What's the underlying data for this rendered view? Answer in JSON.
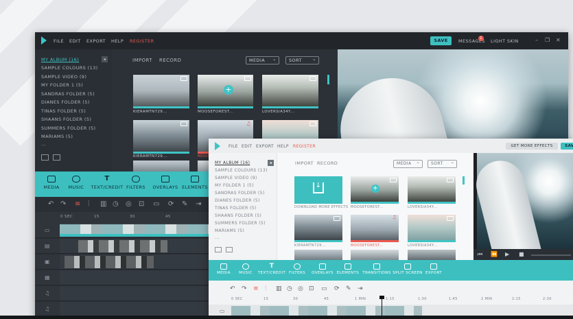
{
  "dark_window": {
    "menu": [
      "FILE",
      "EDIT",
      "EXPORT",
      "HELP",
      "REGISTER"
    ],
    "save_label": "SAVE",
    "messages_label": "MESSAGES",
    "messages_badge": "1",
    "skin_label": "LIGHT SKIN",
    "albums": [
      "MY ALBUM (16)",
      "SAMPLE COLOURS (13)",
      "SAMPLE VIDEO (9)",
      "MY FOLDER 1 (5)",
      "SANDRAS FOLDER (5)",
      "DIANES FOLDER (5)",
      "TINAS FOLDER (5)",
      "SHAANS FOLDER (5)",
      "SUMMERS FOLDER (5)",
      "MARIAMS (5)",
      "..."
    ],
    "import_label": "IMPORT",
    "record_label": "RECORD",
    "media_filter": "MEDIA",
    "sort_filter": "SORT",
    "thumbs": [
      "KIERAMTN729...",
      "MOOSEFOREST...",
      "LOVERSIA34Y...",
      "KIERAMTN729...",
      "MOOSEFOREST...",
      ""
    ],
    "toolbar": [
      "MEDIA",
      "MUSIC",
      "TEXT/CREDIT",
      "FILTERS",
      "OVERLAYS",
      "ELEMENTS"
    ],
    "ruler": [
      "0 SEC",
      "15",
      "30",
      "45"
    ]
  },
  "light_window": {
    "menu": [
      "FILE",
      "EDIT",
      "EXPORT",
      "HELP",
      "REGISTER"
    ],
    "get_more": "GET MORE EFFECTS",
    "save_label": "SAVE",
    "albums": [
      "MY ALBUM (16)",
      "SAMPLE COLOURS (13)",
      "SAMPLE VIDEO (9)",
      "MY FOLDER 1 (5)",
      "SANDRAS FOLDER (5)",
      "DIANES FOLDER (5)",
      "TINAS FOLDER (5)",
      "SHAANS FOLDER (5)",
      "SUMMERS FOLDER (5)",
      "MARIAMS (5)",
      "..."
    ],
    "import_label": "IMPORT",
    "record_label": "RECORD",
    "media_filter": "MEDIA",
    "sort_filter": "SORT",
    "download_label": "DOWNLOAD MORE EFFECTS",
    "thumbs": [
      "MOOSEFOREST...",
      "LOVERSIA34Y...",
      "KIERAMTN729...",
      "MOOSEFOREST...",
      "LOVERSIA34Y..."
    ],
    "toolbar": [
      "MEDIA",
      "MUSIC",
      "TEXT/CREDIT",
      "FILTERS",
      "OVERLAYS",
      "ELEMENTS",
      "TRANSITIONS",
      "SPLIT SCREEN",
      "EXPORT"
    ],
    "ruler": [
      "0 SEC",
      "15",
      "30",
      "45",
      "1 MIN",
      "1:15",
      "1:30",
      "1:45",
      "2 MIN",
      "2:15",
      "2:30"
    ]
  },
  "colors": {
    "accent": "#3dbfc0",
    "register": "#e9594f",
    "dark_bg": "#2a2f35",
    "light_bg": "#f2f3f4"
  }
}
